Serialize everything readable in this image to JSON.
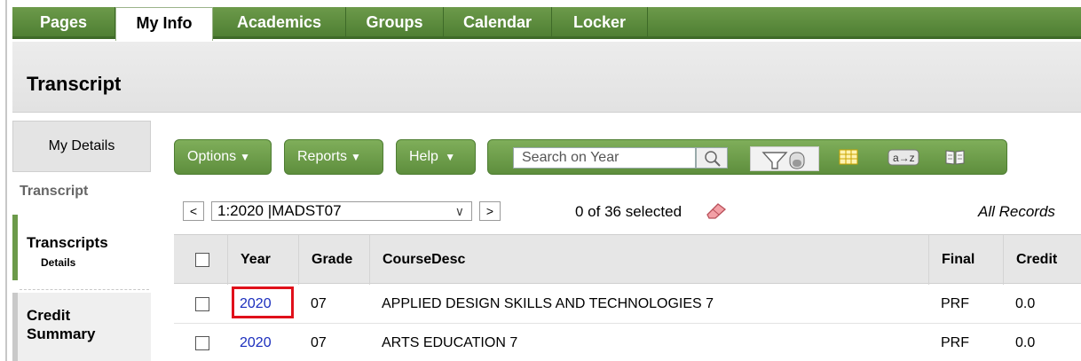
{
  "nav": {
    "tabs": [
      "Pages",
      "My Info",
      "Academics",
      "Groups",
      "Calendar",
      "Locker"
    ],
    "active": "My Info"
  },
  "page": {
    "title": "Transcript"
  },
  "sidebar": {
    "my_details": "My Details",
    "section": "Transcript",
    "items": [
      {
        "label": "Transcripts",
        "sub": "Details"
      },
      {
        "label": "Credit Summary"
      }
    ]
  },
  "toolbar": {
    "options": "Options",
    "reports": "Reports",
    "help": "Help",
    "search_placeholder": "Search on Year"
  },
  "records": {
    "selected_record": "1:2020 |MADST07",
    "prev": "<",
    "next": ">",
    "selection_text": "0 of 36 selected",
    "filter_label": "All Records"
  },
  "table": {
    "columns": [
      "Year",
      "Grade",
      "CourseDesc",
      "Final",
      "Credit"
    ],
    "rows": [
      {
        "year": "2020",
        "grade": "07",
        "course": "APPLIED DESIGN SKILLS AND TECHNOLOGIES 7",
        "final": "PRF",
        "credit": "0.0"
      },
      {
        "year": "2020",
        "grade": "07",
        "course": "ARTS EDUCATION 7",
        "final": "PRF",
        "credit": "0.0"
      }
    ]
  },
  "colors": {
    "accent": "#5e8e3d",
    "highlight": "#e0101a",
    "link": "#1a2dbd"
  }
}
